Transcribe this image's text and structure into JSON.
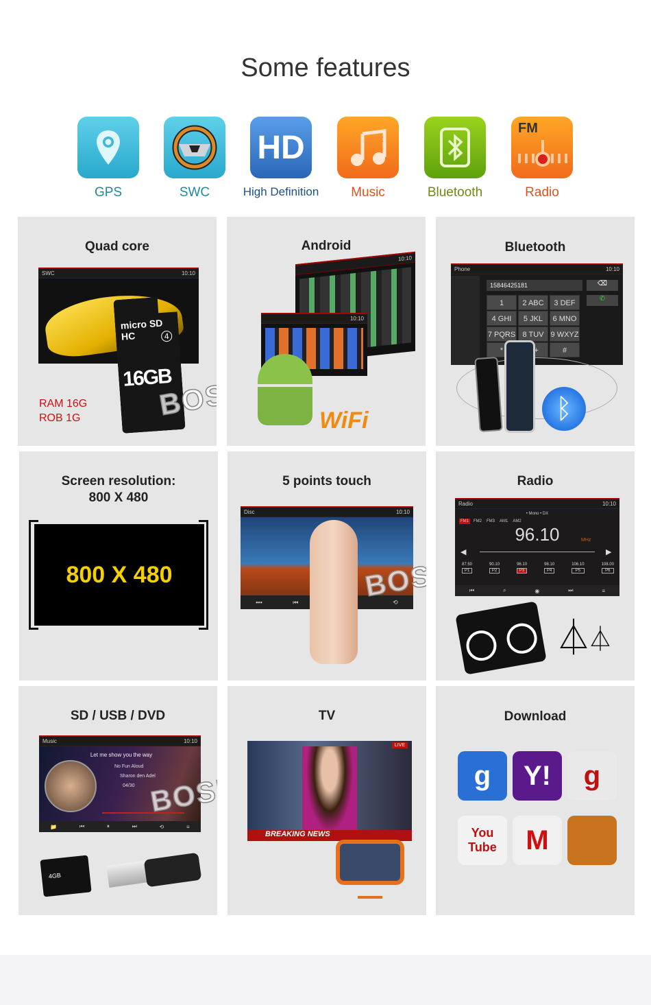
{
  "title": "Some features",
  "features": [
    {
      "label": "GPS",
      "icon": "map-pin-icon",
      "color": "#1e8a9a"
    },
    {
      "label": "SWC",
      "icon": "steering-wheel-icon",
      "color": "#1e8a9a"
    },
    {
      "label": "High Definition",
      "icon_text": "HD",
      "icon": "hd-icon",
      "color": "#1d4f8c"
    },
    {
      "label": "Music",
      "icon": "music-note-icon",
      "color": "#e0521a"
    },
    {
      "label": "Bluetooth",
      "icon": "bluetooth-icon",
      "color": "#6a8a12"
    },
    {
      "label": "Radio",
      "icon_text": "FM",
      "icon": "fm-radio-icon",
      "color": "#e0521a"
    }
  ],
  "watermark": "BOSION",
  "panels": {
    "quad": {
      "title": "Quad core",
      "screen_title": "SWC",
      "time": "10:10",
      "card_brand": "micro SD HC",
      "card_class": "4",
      "card_size": "16GB",
      "ram": "RAM 16G",
      "rom": "ROB 1G"
    },
    "android": {
      "title": "Android",
      "time": "10:10",
      "wifi": "WiFi"
    },
    "bluetooth": {
      "title": "Bluetooth",
      "screen_title": "Phone",
      "time": "10:10",
      "number": "15846425181",
      "keys": [
        "1",
        "2 ABC",
        "3 DEF",
        "4 GHI",
        "5 JKL",
        "6 MNO",
        "7 PQRS",
        "8 TUV",
        "9 WXYZ",
        "*",
        "0 +",
        "#"
      ]
    },
    "resolution": {
      "title_line1": "Screen resolution:",
      "title_line2": "800 X 480",
      "display": "800 X 480",
      "display_color": "#f5d000"
    },
    "touch": {
      "title": "5 points touch",
      "screen_title": "Disc",
      "time": "10:10"
    },
    "radio": {
      "title": "Radio",
      "screen_title": "Radio",
      "time": "10:10",
      "modes": "• Mono  • DX",
      "bands": [
        "FM1",
        "FM2",
        "FM3",
        "AM1",
        "AM2"
      ],
      "frequency": "96.10",
      "unit": "MHz",
      "presets": [
        {
          "freq": "87.50",
          "label": "P1"
        },
        {
          "freq": "90.10",
          "label": "P2"
        },
        {
          "freq": "96.10",
          "label": "P3"
        },
        {
          "freq": "98.10",
          "label": "P4"
        },
        {
          "freq": "106.10",
          "label": "P5"
        },
        {
          "freq": "108.00",
          "label": "P6"
        }
      ]
    },
    "media": {
      "title": "SD / USB / DVD",
      "screen_title": "Music",
      "time": "10:10",
      "song": "Let me show you the way",
      "album": "No Fun Aloud",
      "artist": "Sharon den Adel",
      "track": "04/30",
      "card": "4GB"
    },
    "tv": {
      "title": "TV",
      "live": "LIVE",
      "news": "BREAKING NEWS"
    },
    "download": {
      "title": "Download",
      "apps": [
        {
          "name": "google-search-icon",
          "text": "g",
          "bg": "#2a6fd6"
        },
        {
          "name": "yahoo-icon",
          "text": "Y!",
          "bg": "#5b1a8c"
        },
        {
          "name": "google-maps-icon",
          "text": "g",
          "bg": "#e9e9e9"
        },
        {
          "name": "youtube-icon",
          "text": "You Tube",
          "bg": "#f2f2f2"
        },
        {
          "name": "gmail-icon",
          "text": "M",
          "bg": "#f0f0f0"
        },
        {
          "name": "bird-app-icon",
          "text": "",
          "bg": "#c8741e"
        }
      ]
    }
  }
}
